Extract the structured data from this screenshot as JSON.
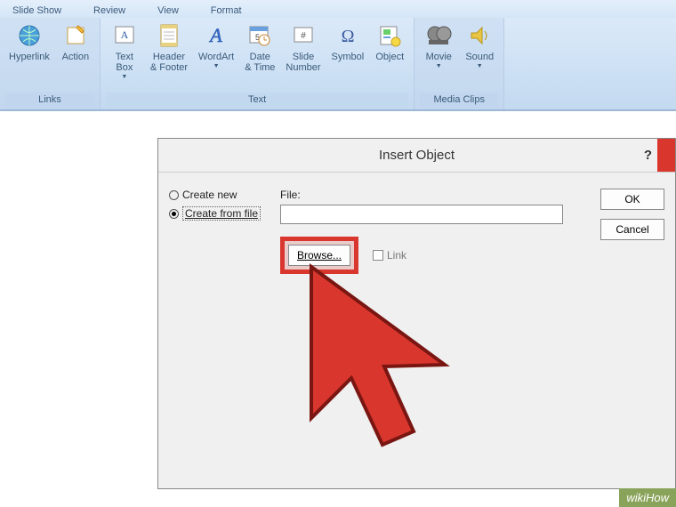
{
  "tabs": {
    "slideshow": "Slide Show",
    "review": "Review",
    "view": "View",
    "format": "Format"
  },
  "ribbon": {
    "links": {
      "label": "Links",
      "hyperlink": "Hyperlink",
      "action": "Action"
    },
    "text": {
      "label": "Text",
      "textbox_l1": "Text",
      "textbox_l2": "Box",
      "header_l1": "Header",
      "header_l2": "& Footer",
      "wordart": "WordArt",
      "datetime_l1": "Date",
      "datetime_l2": "& Time",
      "slidenum_l1": "Slide",
      "slidenum_l2": "Number",
      "symbol": "Symbol",
      "object": "Object"
    },
    "media": {
      "label": "Media Clips",
      "movie": "Movie",
      "sound": "Sound"
    }
  },
  "dialog": {
    "title": "Insert Object",
    "help": "?",
    "create_new": "Create new",
    "create_from_file": "Create from file",
    "file_label": "File:",
    "browse": "Browse...",
    "link": "Link",
    "ok": "OK",
    "cancel": "Cancel"
  },
  "watermark": "wikiHow"
}
